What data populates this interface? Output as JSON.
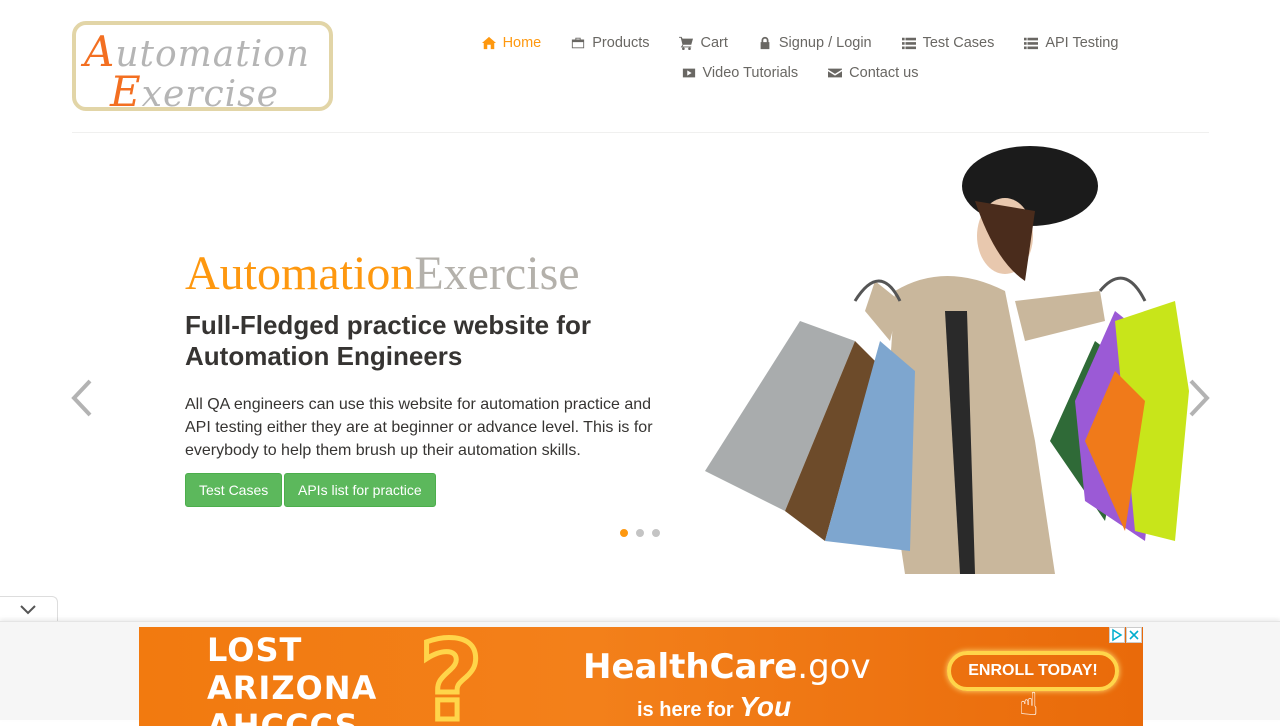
{
  "logo": {
    "line1_cap": "A",
    "line1_rest": "utomation",
    "line2_cap": "E",
    "line2_rest": "xercise"
  },
  "nav": {
    "items": [
      {
        "label": "Home",
        "icon": "home-icon",
        "active": true
      },
      {
        "label": "Products",
        "icon": "briefcase-icon"
      },
      {
        "label": "Cart",
        "icon": "cart-icon"
      },
      {
        "label": "Signup / Login",
        "icon": "lock-icon"
      },
      {
        "label": "Test Cases",
        "icon": "list-icon"
      },
      {
        "label": "API Testing",
        "icon": "list-icon"
      },
      {
        "label": "Video Tutorials",
        "icon": "youtube-icon"
      },
      {
        "label": "Contact us",
        "icon": "envelope-icon"
      }
    ]
  },
  "slider": {
    "brand_a": "Automation",
    "brand_b": "Exercise",
    "headline": "Full-Fledged practice website for Automation Engineers",
    "description": "All QA engineers can use this website for automation practice and API testing either they are at beginner or advance level. This is for everybody to help them brush up their automation skills.",
    "btn_test_cases": "Test Cases",
    "btn_apis": "APIs list for practice",
    "slide_count": 3,
    "active_slide": 0
  },
  "ad": {
    "lost_line1": "LOST",
    "lost_line2": "ARIZONA",
    "lost_line3": "AHCCCS",
    "brand": "HealthCare",
    "brand_gov": ".gov",
    "sub": "is here for",
    "you": "You",
    "cta": "ENROLL TODAY!"
  },
  "colors": {
    "accent": "#fe980f",
    "button": "#5cb85c",
    "nav_text": "#696763"
  }
}
